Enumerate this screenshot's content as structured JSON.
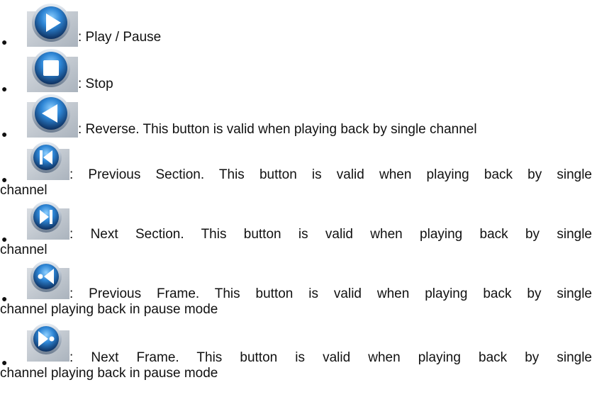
{
  "items": [
    {
      "icon": "play-icon",
      "text": ": Play / Pause"
    },
    {
      "icon": "stop-icon",
      "text": ": Stop"
    },
    {
      "icon": "reverse-icon",
      "text": ": Reverse. This button is valid when playing back by single channel"
    },
    {
      "icon": "previous-section-icon",
      "text": ": Previous Section. This button is valid when playing back by single",
      "text2": "channel"
    },
    {
      "icon": "next-section-icon",
      "text": ": Next Section. This button is valid when playing back by single",
      "text2": "channel"
    },
    {
      "icon": "previous-frame-icon",
      "text": ": Previous Frame. This button is valid when playing back by single",
      "text2": "channel playing back in pause mode"
    },
    {
      "icon": "next-frame-icon",
      "text": ": Next Frame. This button is valid when playing back by single",
      "text2": "channel playing back in pause mode"
    }
  ],
  "colors": {
    "icon_outer": "#2a4a7a",
    "icon_inner": "#3a8fd9",
    "icon_glyph": "#ffffff",
    "icon_backdrop": "#c9cfd6"
  }
}
